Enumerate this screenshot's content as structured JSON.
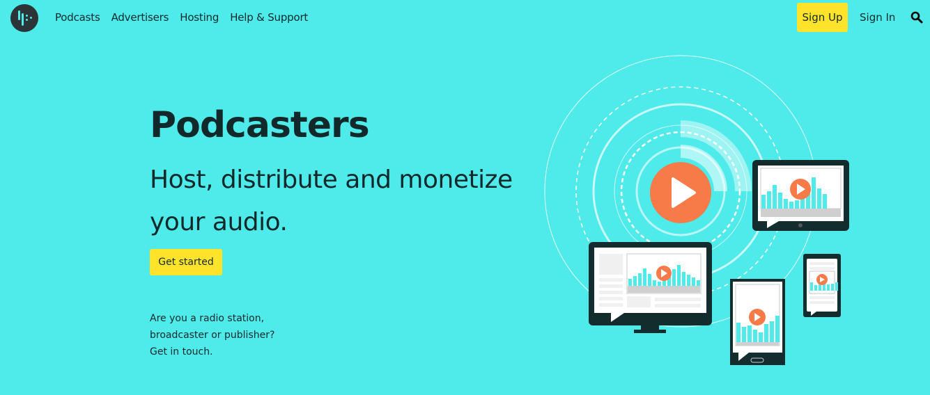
{
  "nav": {
    "logo_icon": "podcast-logo-icon",
    "links": [
      {
        "label": "Podcasts"
      },
      {
        "label": "Advertisers"
      },
      {
        "label": "Hosting"
      },
      {
        "label": "Help & Support"
      }
    ],
    "signup_label": "Sign Up",
    "signin_label": "Sign In",
    "search_icon": "search-icon"
  },
  "hero": {
    "title": "Podcasters",
    "subtitle": "Host, distribute and monetize your audio.",
    "cta_label": "Get started",
    "contact_lines": [
      "Are you a radio station,",
      "broadcaster or publisher?",
      "Get in touch."
    ]
  },
  "illustration": {
    "description": "devices-broadcasting-illustration",
    "colors": {
      "play": "#f77b48",
      "device": "#132d2e",
      "bar": "#4eebea",
      "screen": "#ffffff"
    }
  },
  "colors": {
    "background": "#4eebea",
    "accent_button": "#ffe32a",
    "text": "#11292b"
  }
}
